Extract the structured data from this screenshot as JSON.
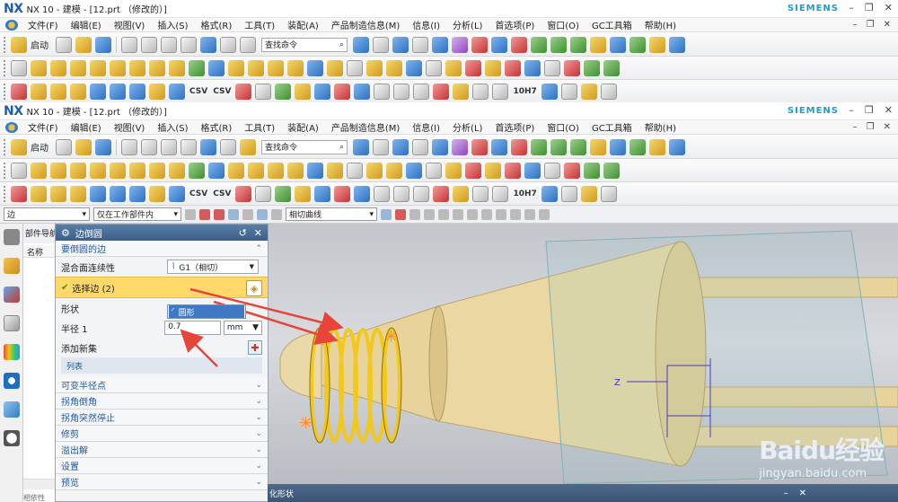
{
  "window1": {
    "logo": "NX",
    "title": "NX 10 - 建模 - [12.prt （修改的）]",
    "brand": "SIEMENS"
  },
  "window2": {
    "logo": "NX",
    "title": "NX 10 - 建模 - [12.prt （修改的）]",
    "brand": "SIEMENS"
  },
  "window_controls": [
    "–",
    "❐",
    "✕"
  ],
  "menu_controls": [
    "–",
    "❐",
    "✕"
  ],
  "menus": [
    "文件(F)",
    "编辑(E)",
    "视图(V)",
    "插入(S)",
    "格式(R)",
    "工具(T)",
    "装配(A)",
    "产品制造信息(M)",
    "信息(I)",
    "分析(L)",
    "首选项(P)",
    "窗口(O)",
    "GC工具箱",
    "帮助(H)"
  ],
  "toolbar": {
    "start_label": "启动",
    "search_placeholder": "查找命令",
    "csv_label": "CSV",
    "h7_label": "10H7"
  },
  "selection_bar": {
    "filter_type": "边",
    "scope": "仅在工作部件内",
    "curve_rule": "相切曲线"
  },
  "nav_panel": {
    "header": "部件导航器",
    "column": "名称",
    "bottom": "相依性"
  },
  "dialog": {
    "title": "边倒圆",
    "section_edges": "要倒圆的边",
    "blend_continuity_label": "混合面连续性",
    "blend_continuity_value": "G1（相切）",
    "select_edge_label": "选择边 (2)",
    "shape_label": "形状",
    "shape_option": "圆形",
    "radius_label": "半径 1",
    "radius_value": "0.7",
    "radius_unit": "mm",
    "add_new_set_label": "添加新集",
    "list_label": "列表",
    "collapsed_sections": [
      "可变半径点",
      "拐角倒角",
      "拐角突然停止",
      "修剪",
      "溢出解",
      "设置",
      "预览"
    ]
  },
  "status_bar": {
    "text": "化形状"
  },
  "viewport": {
    "axis_label": "Z"
  },
  "watermark": {
    "brand": "Baidu经验",
    "url": "jingyan.baidu.com"
  },
  "colors": {
    "accent": "#3b5f8a",
    "part_color": "#e6cc8e",
    "spring_color": "#f2c81a",
    "arrow_color": "#e8453a"
  }
}
